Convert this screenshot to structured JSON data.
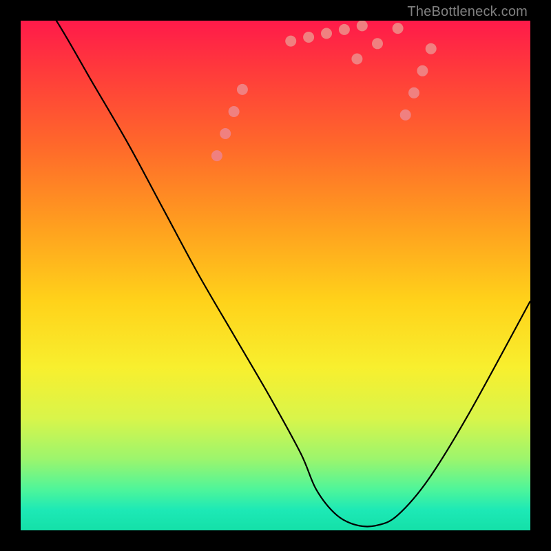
{
  "watermark": "TheBottleneck.com",
  "colors": {
    "marker": "#f08080",
    "curve": "#000000"
  },
  "chart_data": {
    "type": "line",
    "title": "",
    "xlabel": "",
    "ylabel": "",
    "xlim": [
      0,
      100
    ],
    "ylim": [
      0,
      100
    ],
    "x": [
      0,
      7,
      14,
      21,
      28,
      35,
      42,
      49,
      55,
      58,
      62,
      66,
      70,
      74,
      80,
      88,
      100
    ],
    "values": [
      110,
      100,
      88,
      76,
      63,
      50,
      38,
      26,
      15,
      8,
      3,
      1,
      1,
      3,
      10,
      23,
      45
    ],
    "marker_clusters": [
      {
        "x_center": 41.0,
        "y_center": 80.0,
        "count": 4,
        "spread_x": 2.5,
        "spread_y": 6.5
      },
      {
        "x_center": 60.0,
        "y_center": 97.5,
        "count": 5,
        "spread_x": 7.0,
        "spread_y": 1.5
      },
      {
        "x_center": 70.0,
        "y_center": 95.5,
        "count": 3,
        "spread_x": 4.0,
        "spread_y": 3.0
      },
      {
        "x_center": 78.0,
        "y_center": 88.0,
        "count": 4,
        "spread_x": 2.5,
        "spread_y": 6.5
      }
    ]
  }
}
